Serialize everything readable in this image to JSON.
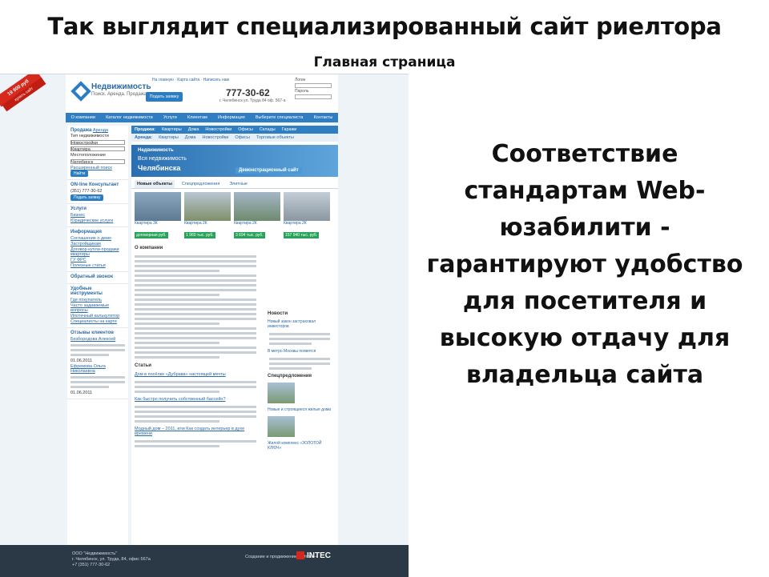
{
  "slide": {
    "title": "Так выглядит специализированный сайт риелтора",
    "subtitle": "Главная страница",
    "caption_lines": [
      "Соответствие",
      "стандартам Web-",
      "юзабилити -",
      "гарантируют удобство",
      "для посетителя и",
      "высокую отдачу для",
      "владельца сайта"
    ]
  },
  "screenshot": {
    "promo": {
      "price": "19 900 руб",
      "action": "купить сайт",
      "sub": "подробнее"
    },
    "header": {
      "logo_name": "Недвижимость",
      "logo_tagline": "Поиск. Аренда. Продажа",
      "top_links": "На главную  ·  Карта сайта  ·  Написать нам",
      "phone": "777-30-62",
      "address": "г. Челябинск ул. Труда 84 оф. 567-а",
      "request_button": "Подать заявку",
      "login_label": "Логин",
      "password_label": "Пароль"
    },
    "menu": [
      "О компании",
      "Каталог недвижимости",
      "Услуги",
      "Клиентам",
      "Информация",
      "Выберите специалиста",
      "Контакты"
    ],
    "sidebar": {
      "search_tabs": [
        "Продажа",
        "Аренда"
      ],
      "search_fields": [
        "Тип недвижимости",
        "Новостройки",
        "Квартира",
        "Местоположение",
        "Челябинск"
      ],
      "search_button": "Найти",
      "advanced_link": "Расширенный поиск",
      "consultant_title": "ON-line Консультант",
      "consultant_phone": "(351) 777-30-62",
      "consultant_button": "Подать заявку",
      "services_title": "Услуги",
      "services": [
        "Бизнес",
        "Юридические услуги"
      ],
      "info_title": "Информация",
      "info_links": [
        "Соглашение о демо",
        "Застройщикам",
        "Договор купли-продажи квартиры",
        "ГУ ФРС",
        "Полезные статьи"
      ],
      "callback_title": "Обратный звонок",
      "tools_title": "Удобные инструменты",
      "tools": [
        "Где покупатель",
        "Часто задаваемые вопросы",
        "Ипотечный калькулятор",
        "Специалисты на карте"
      ],
      "reviews_title": "Отзывы клиентов",
      "reviewers": [
        "Безбородова Алексей",
        "Ефремова Ольга Николаевна"
      ],
      "review_dates": [
        "01.06.2011",
        "01.06.2011"
      ]
    },
    "main": {
      "sales_label": "Продажа:",
      "sales_items": [
        "Квартиры",
        "Дома",
        "Новостройки",
        "Офисы",
        "Склады",
        "Гаражи"
      ],
      "rent_label": "Аренда:",
      "rent_items": [
        "Квартиры",
        "Дома",
        "Новостройки",
        "Офисы",
        "Торговые объекты"
      ],
      "banner_logo": "Недвижимость",
      "banner_line1": "Вся недвижимость",
      "banner_line2": "Челябинска",
      "banner_demo": "Демонстрационный сайт",
      "object_tabs": [
        "Новые объекты",
        "Спецпредложения",
        "Элитные"
      ],
      "objects": [
        {
          "kind": "Квартира 3К",
          "price": "договорная руб."
        },
        {
          "kind": "Квартира 2К",
          "price": "1 960 тыс. руб."
        },
        {
          "kind": "Квартира 2К",
          "price": "3 694 тыс. руб."
        },
        {
          "kind": "Квартира 2К",
          "price": "157 940 тыс. руб."
        }
      ],
      "about_title": "О компании",
      "articles_title": "Статьи",
      "articles": [
        "Дом в посёлке «Дубрава» настоящей мечты",
        "Как быстро получить собственный бассейн?",
        "Модный дом – 2011, или Как создать интерьер в духе времени"
      ]
    },
    "news": {
      "title": "Новости",
      "items": [
        "Новый закон застраховал инвесторов",
        "В метро Москвы появятся"
      ],
      "special_title": "Спецпредложения",
      "offers": [
        "Новые и строящиеся жилые дома",
        "Жилой комплекс «ЗОЛОТОЙ КЛЮЧ»"
      ]
    },
    "footer": {
      "company": "ООО \"Недвижимость\"",
      "address": "г. Челябинск, ул. Труда, 84, офис 567а",
      "phone": "+7 (351) 777-30-62",
      "developer": "Создание и продвижение сайтов —",
      "developer_name": "INTEC"
    }
  }
}
